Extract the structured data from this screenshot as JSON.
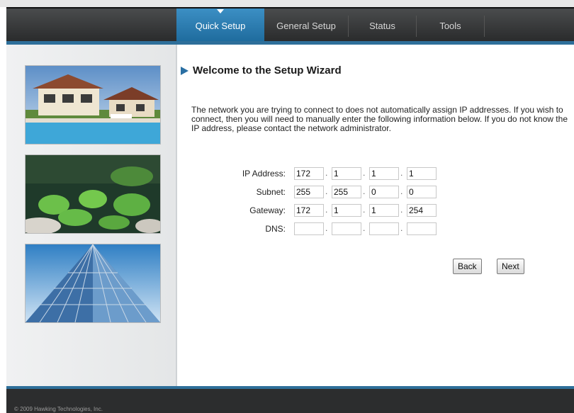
{
  "nav": {
    "tabs": [
      {
        "label": "Quick Setup",
        "active": true
      },
      {
        "label": "General Setup",
        "active": false
      },
      {
        "label": "Status",
        "active": false
      },
      {
        "label": "Tools",
        "active": false
      }
    ]
  },
  "main": {
    "title": "Welcome to the Setup Wizard",
    "description": "The network you are trying to connect to does not automatically assign IP addresses. If you wish to connect, then you will need to manually enter the following information below. If you do not know the IP address, please contact the network administrator.",
    "form": {
      "ip": {
        "label": "IP Address:",
        "octets": [
          "172",
          "1",
          "1",
          "1"
        ]
      },
      "subnet": {
        "label": "Subnet:",
        "octets": [
          "255",
          "255",
          "0",
          "0"
        ]
      },
      "gateway": {
        "label": "Gateway:",
        "octets": [
          "172",
          "1",
          "1",
          "254"
        ]
      },
      "dns": {
        "label": "DNS:",
        "octets": [
          "",
          "",
          "",
          ""
        ]
      }
    },
    "buttons": {
      "back": "Back",
      "next": "Next"
    }
  },
  "footer": {
    "copyright": "© 2009 Hawking Technologies, Inc."
  },
  "colors": {
    "accent": "#2e6f9a",
    "active_tab": "#2a83bd",
    "header": "#3a3b3c"
  }
}
